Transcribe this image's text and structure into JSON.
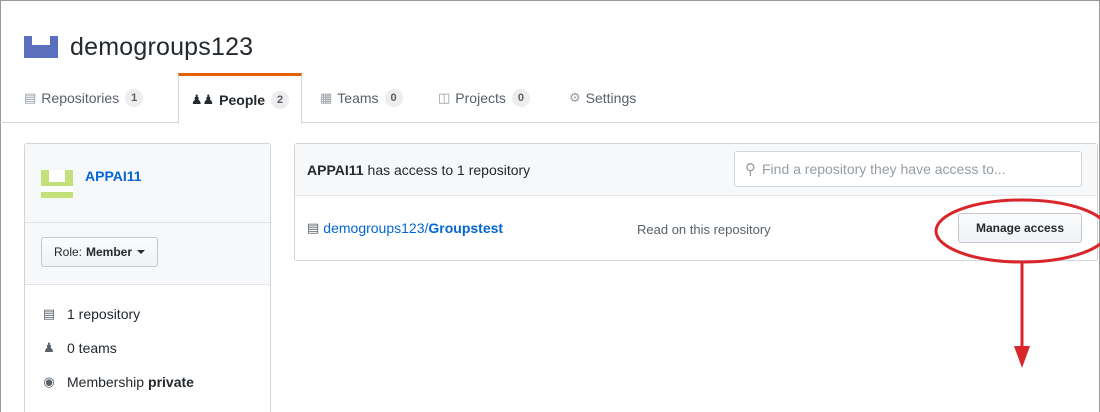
{
  "org": {
    "name": "demogroups123"
  },
  "tabs": [
    {
      "label": "Repositories",
      "count": "1",
      "icon": "repo-icon"
    },
    {
      "label": "People",
      "count": "2",
      "icon": "people-icon"
    },
    {
      "label": "Teams",
      "count": "0",
      "icon": "jersey-icon"
    },
    {
      "label": "Projects",
      "count": "0",
      "icon": "project-icon"
    },
    {
      "label": "Settings",
      "icon": "gear-icon"
    }
  ],
  "sidebar": {
    "username": "APPAI11",
    "role_prefix": "Role:",
    "role_value": "Member",
    "stats": [
      {
        "text": "1 repository",
        "icon": "repo-icon"
      },
      {
        "text": "0 teams",
        "icon": "people-icon"
      },
      {
        "text": "Membership",
        "bold": "private",
        "icon": "eye-icon"
      }
    ]
  },
  "main": {
    "header_user": "APPAI11",
    "header_text": "has access to 1 repository",
    "search_placeholder": "Find a repository they have access to...",
    "repo_owner": "demogroups123/",
    "repo_name": "Groupstest",
    "permission": "Read on this repository",
    "manage_label": "Manage access"
  },
  "colors": {
    "accent_tab": "#e36209",
    "link": "#0366d6",
    "annotation": "#d9262b"
  }
}
